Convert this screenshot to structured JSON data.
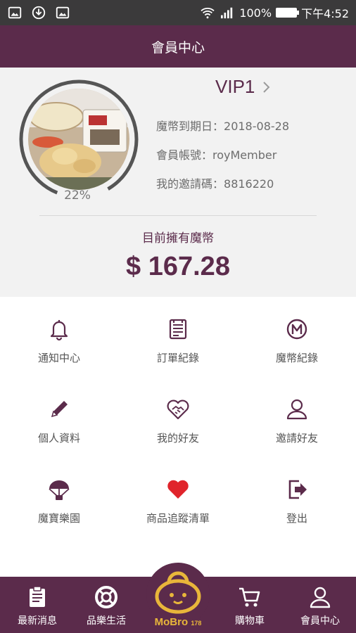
{
  "status_bar": {
    "battery": "100%",
    "time": "下午4:52",
    "left_icons": [
      "image-icon",
      "download-icon",
      "image-icon"
    ],
    "right_icons": [
      "wifi-icon",
      "signal-icon",
      "battery-icon"
    ]
  },
  "header": {
    "title": "會員中心"
  },
  "profile": {
    "vip_level": "VIP1",
    "progress_percent": 22,
    "progress_label": "22%",
    "coin_expiry_label": "魔幣到期日：",
    "coin_expiry_value": "2018-08-28",
    "account_label": "會員帳號：",
    "account_value": "royMember",
    "invite_label": "我的邀請碼：",
    "invite_value": "8816220",
    "coin_title": "目前擁有魔幣",
    "coin_amount": "$ 167.28"
  },
  "menu": {
    "items": [
      {
        "label": "通知中心",
        "icon": "bell-icon"
      },
      {
        "label": "訂單紀錄",
        "icon": "order-list-icon"
      },
      {
        "label": "魔幣紀錄",
        "icon": "m-coin-icon"
      },
      {
        "label": "個人資料",
        "icon": "pencil-icon"
      },
      {
        "label": "我的好友",
        "icon": "handshake-heart-icon"
      },
      {
        "label": "邀請好友",
        "icon": "person-icon"
      },
      {
        "label": "魔寶樂園",
        "icon": "parachute-icon"
      },
      {
        "label": "商品追蹤清單",
        "icon": "heart-icon"
      },
      {
        "label": "登出",
        "icon": "logout-icon"
      }
    ]
  },
  "bottom_nav": {
    "items": [
      {
        "label": "最新消息",
        "icon": "clipboard-icon"
      },
      {
        "label": "品樂生活",
        "icon": "lifebuoy-icon"
      },
      {
        "label": "購物車",
        "icon": "cart-icon"
      },
      {
        "label": "會員中心",
        "icon": "user-icon"
      }
    ],
    "logo_text": "MoBro",
    "logo_suffix": "178"
  },
  "colors": {
    "brand": "#5b2b4b",
    "gold": "#e8b63a",
    "heart": "#e0242b",
    "profile_bg": "#f2f2f2"
  }
}
